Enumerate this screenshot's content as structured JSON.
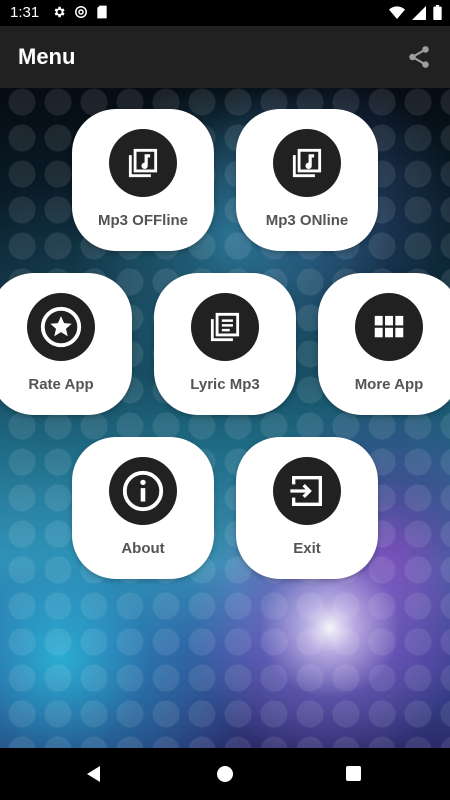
{
  "status_bar": {
    "time": "1:31",
    "left_icons": [
      "gear-icon",
      "at-sign-icon",
      "sd-card-icon"
    ],
    "right_icons": [
      "wifi-icon",
      "signal-icon",
      "battery-icon"
    ]
  },
  "app_bar": {
    "title": "Menu",
    "share_icon": "share-icon"
  },
  "menu": {
    "items": [
      {
        "label": "Mp3 OFFline",
        "icon": "library-music-icon"
      },
      {
        "label": "Mp3 ONline",
        "icon": "library-music-icon"
      },
      {
        "label": "Rate App",
        "icon": "star-icon"
      },
      {
        "label": "Lyric Mp3",
        "icon": "library-books-icon"
      },
      {
        "label": "More App",
        "icon": "apps-grid-icon"
      },
      {
        "label": "About",
        "icon": "info-icon"
      },
      {
        "label": "Exit",
        "icon": "exit-icon"
      }
    ]
  },
  "nav_bar": {
    "icons": [
      "back-icon",
      "home-icon",
      "recents-icon"
    ]
  },
  "colors": {
    "tile_background": "#ffffff",
    "icon_circle": "#212121",
    "label_text": "#555555",
    "app_bar": "#212121"
  }
}
